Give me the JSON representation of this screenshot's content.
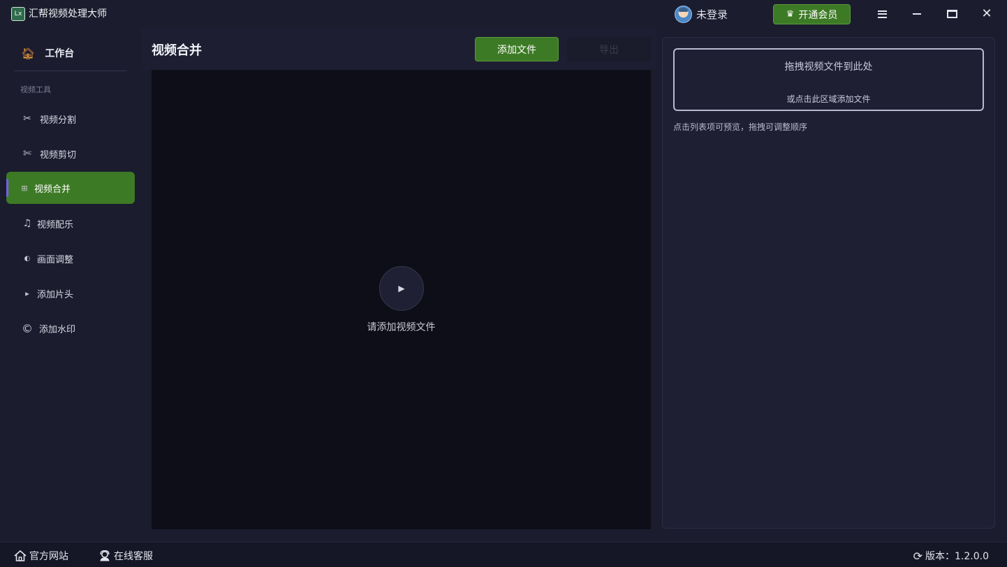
{
  "app": {
    "title": "汇帮视频处理大师",
    "logo_text": "Lx"
  },
  "titlebar": {
    "user_label": "未登录",
    "vip_label": "开通会员",
    "icons": [
      "hamburger-menu-icon",
      "minimize-icon",
      "maximize-icon",
      "close-icon"
    ]
  },
  "sidebar": {
    "workbench_label": "工作台",
    "section_label": "视频工具",
    "items": [
      {
        "label": "视频分割",
        "icon": "✂",
        "active": false
      },
      {
        "label": "视频剪切",
        "icon": "✄",
        "active": false
      },
      {
        "label": "视频合并",
        "icon": "⊞",
        "active": true
      },
      {
        "label": "视频配乐",
        "icon": "♫",
        "active": false
      },
      {
        "label": "画面调整",
        "icon": "◐",
        "active": false
      },
      {
        "label": "添加片头",
        "icon": "▸",
        "active": false
      },
      {
        "label": "添加水印",
        "icon": "©",
        "active": false
      }
    ]
  },
  "main": {
    "page_title": "视频合并",
    "add_file_label": "添加文件",
    "export_label": "导出",
    "empty_hint": "请添加视频文件"
  },
  "right_panel": {
    "drop_title": "拖拽视频文件到此处",
    "drop_sub": "或点击此区域添加文件",
    "list_hint": "点击列表项可预览，拖拽可调整顺序"
  },
  "bottombar": {
    "site_label": "官方网站",
    "service_label": "在线客服",
    "version_label": "版本：1.2.0.0"
  },
  "colors": {
    "accent_green": "#3d7a25",
    "background": "#1b1c2e",
    "preview_bg": "#0e0e18",
    "active_indicator": "#7a5cf0"
  }
}
